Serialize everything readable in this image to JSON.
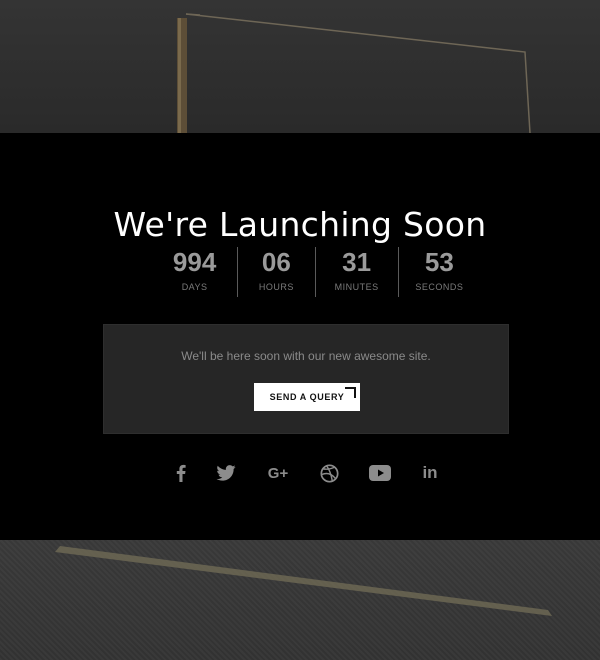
{
  "hero": {
    "title": "We're Launching Soon"
  },
  "countdown": [
    {
      "value": "994",
      "label": "DAYS"
    },
    {
      "value": "06",
      "label": "HOURS"
    },
    {
      "value": "31",
      "label": "MINUTES"
    },
    {
      "value": "53",
      "label": "SECONDS"
    }
  ],
  "notice": {
    "message": "We'll be here soon with our new awesome site.",
    "button_label": "SEND A QUERY"
  },
  "social": [
    {
      "icon": "facebook-icon"
    },
    {
      "icon": "twitter-icon"
    },
    {
      "icon": "google-plus-icon",
      "text": "G+"
    },
    {
      "icon": "dribbble-icon"
    },
    {
      "icon": "youtube-icon"
    },
    {
      "icon": "linkedin-icon",
      "text": "in"
    }
  ],
  "colors": {
    "panel_bg": "#000000",
    "box_bg": "#262626",
    "muted_text": "#8a8a8a",
    "button_bg": "#ffffff"
  }
}
